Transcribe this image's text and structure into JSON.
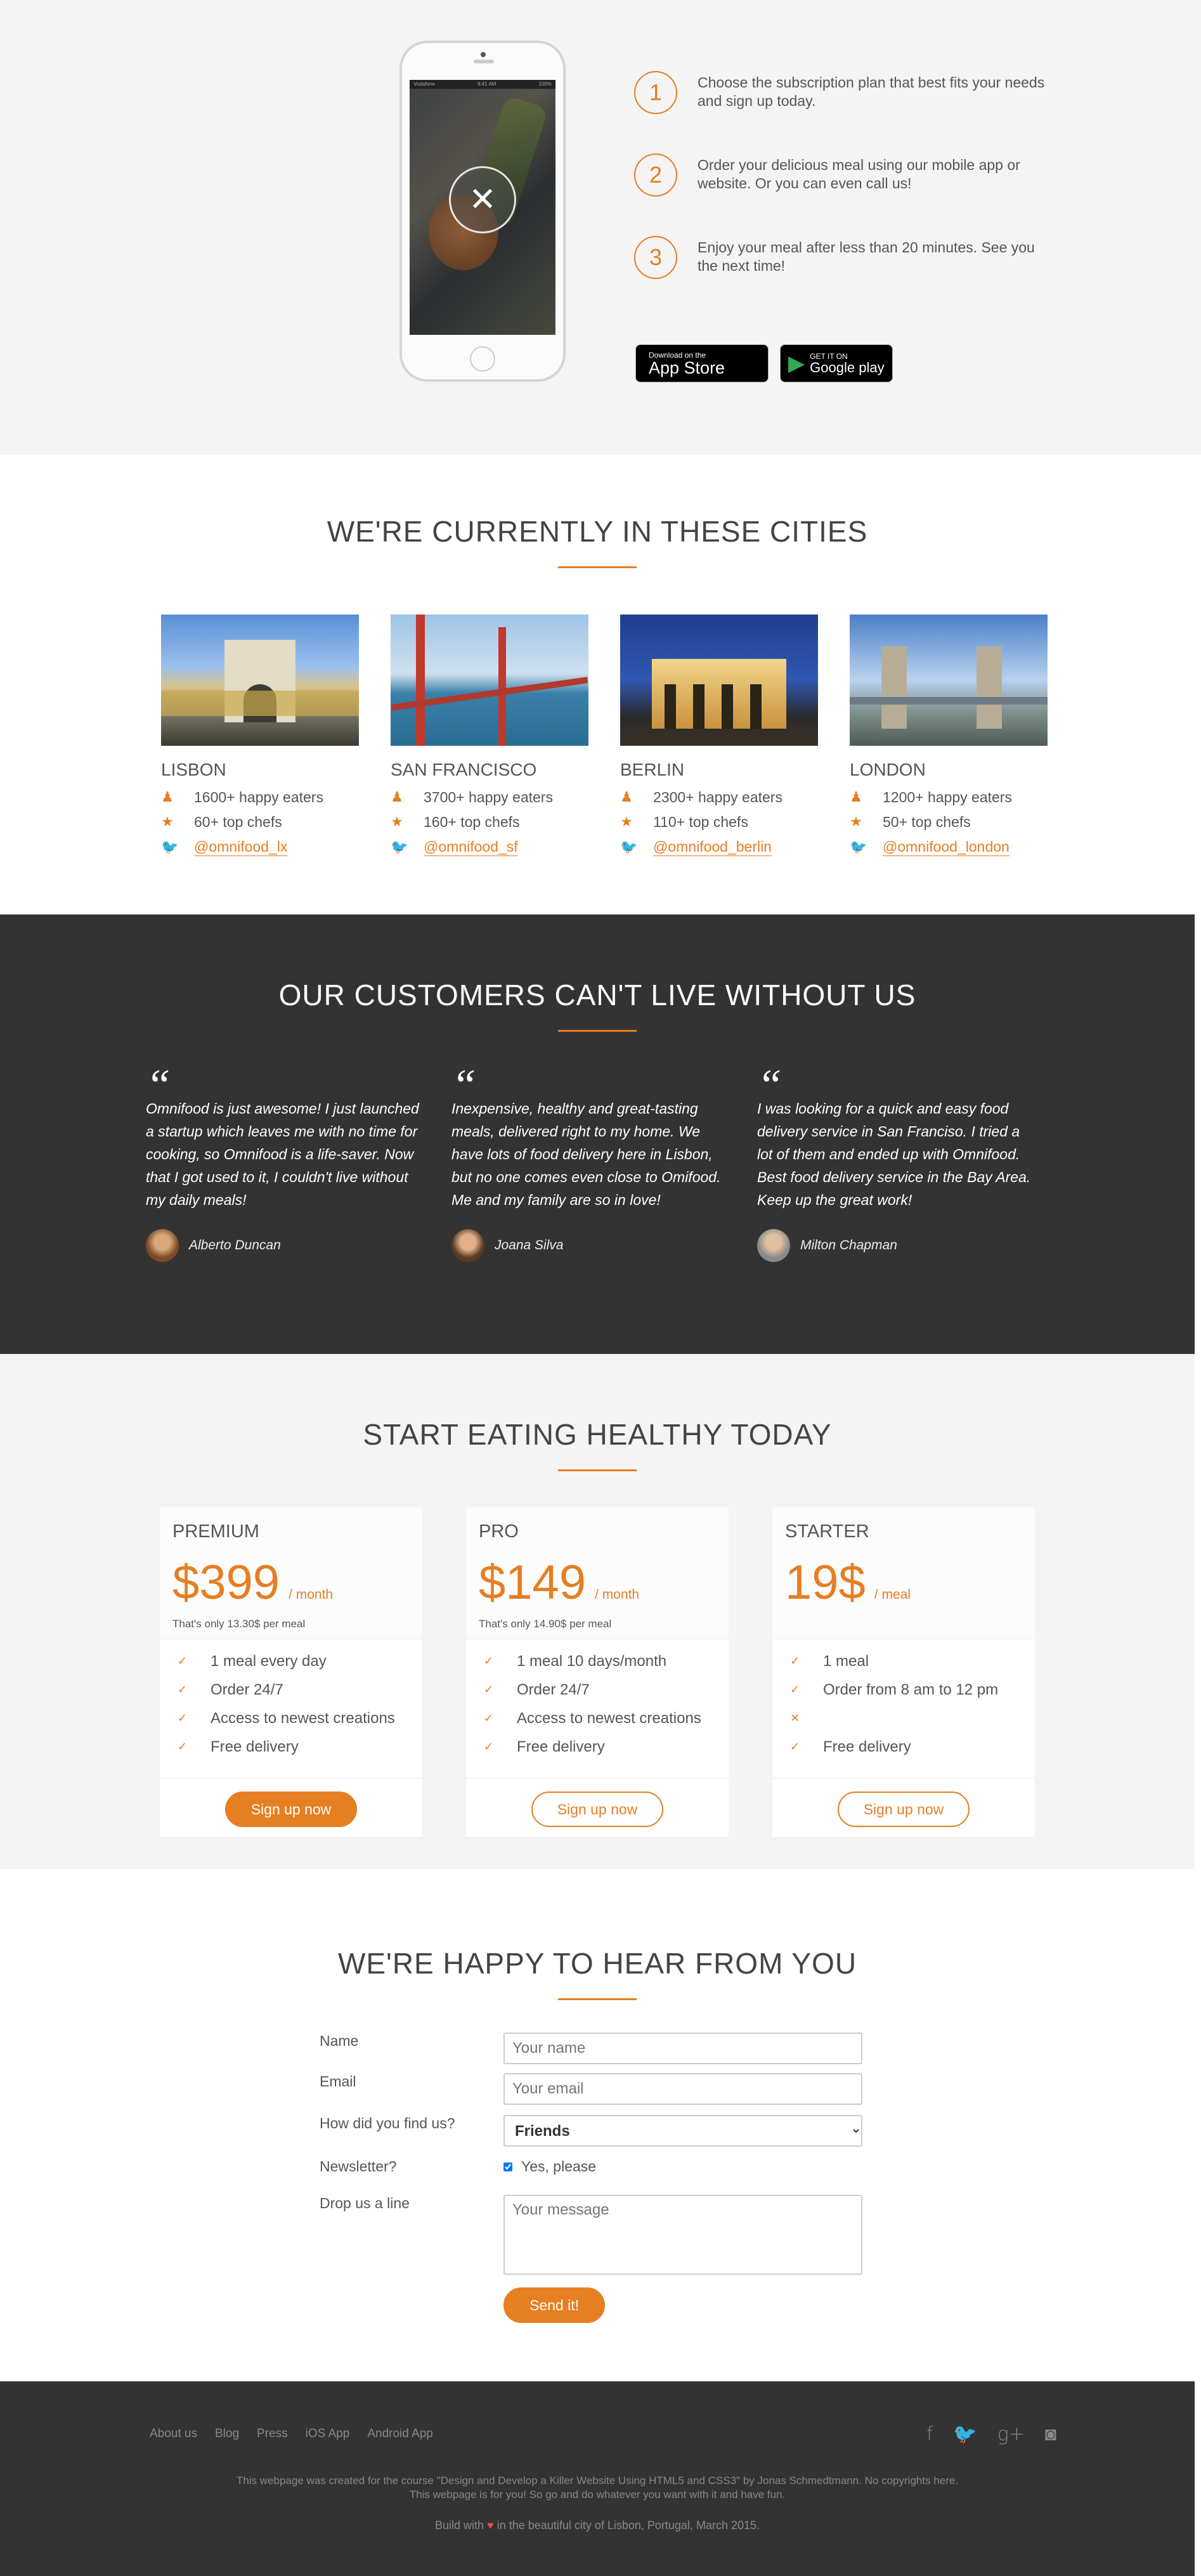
{
  "steps": {
    "items": [
      {
        "num": "1",
        "text": "Choose the subscription plan that best fits your needs and sign up today."
      },
      {
        "num": "2",
        "text": "Order your delicious meal using our mobile app or website. Or you can even call us!"
      },
      {
        "num": "3",
        "text": "Enjoy your meal after less than 20 minutes. See you the next time!"
      }
    ],
    "appstore": {
      "small": "Download on the",
      "big": "App Store",
      "icon": "apple-icon"
    },
    "googleplay": {
      "small": "GET IT ON",
      "big": "Google play",
      "icon": "play-icon"
    },
    "phone": {
      "carrier": "Vodafone",
      "time": "9:41 AM",
      "battery": "100%"
    }
  },
  "cities": {
    "title": "WE'RE CURRENTLY IN THESE CITIES",
    "items": [
      {
        "name": "LISBON",
        "eaters": "1600+ happy eaters",
        "chefs": "60+ top chefs",
        "twitter": "@omnifood_lx"
      },
      {
        "name": "SAN FRANCISCO",
        "eaters": "3700+ happy eaters",
        "chefs": "160+ top chefs",
        "twitter": "@omnifood_sf"
      },
      {
        "name": "BERLIN",
        "eaters": "2300+ happy eaters",
        "chefs": "110+ top chefs",
        "twitter": "@omnifood_berlin"
      },
      {
        "name": "LONDON",
        "eaters": "1200+ happy eaters",
        "chefs": "50+ top chefs",
        "twitter": "@omnifood_london"
      }
    ]
  },
  "testimonials": {
    "title": "OUR CUSTOMERS CAN'T LIVE WITHOUT US",
    "items": [
      {
        "text": "Omnifood is just awesome! I just launched a startup which leaves me with no time for cooking, so Omnifood is a life-saver. Now that I got used to it, I couldn't live without my daily meals!",
        "name": "Alberto Duncan"
      },
      {
        "text": "Inexpensive, healthy and great-tasting meals, delivered right to my home. We have lots of food delivery here in Lisbon, but no one comes even close to Omifood. Me and my family are so in love!",
        "name": "Joana Silva"
      },
      {
        "text": "I was looking for a quick and easy food delivery service in San Franciso. I tried a lot of them and ended up with Omnifood. Best food delivery service in the Bay Area. Keep up the great work!",
        "name": "Milton Chapman"
      }
    ]
  },
  "pricing": {
    "title": "START EATING HEALTHY TODAY",
    "plans": [
      {
        "name": "PREMIUM",
        "price": "$399",
        "per": "/ month",
        "note": "That's only 13.30$ per meal",
        "features": [
          "1 meal every day",
          "Order 24/7",
          "Access to newest creations",
          "Free delivery"
        ],
        "button": "Sign up now"
      },
      {
        "name": "PRO",
        "price": "$149",
        "per": "/ month",
        "note": "That's only 14.90$ per meal",
        "features": [
          "1 meal 10 days/month",
          "Order 24/7",
          "Access to newest creations",
          "Free delivery"
        ],
        "button": "Sign up now"
      },
      {
        "name": "STARTER",
        "price": "19$",
        "per": "/ meal",
        "note": "",
        "features": [
          "1 meal",
          "Order from 8 am to 12 pm",
          "",
          "Free delivery"
        ],
        "button": "Sign up now"
      }
    ]
  },
  "contact": {
    "title": "WE'RE HAPPY TO HEAR FROM YOU",
    "name_label": "Name",
    "name_placeholder": "Your name",
    "email_label": "Email",
    "email_placeholder": "Your email",
    "find_label": "How did you find us?",
    "find_value": "Friends",
    "newsletter_label": "Newsletter?",
    "newsletter_option": "Yes, please",
    "message_label": "Drop us a line",
    "message_placeholder": "Your message",
    "send": "Send it!"
  },
  "footer": {
    "nav": [
      "About us",
      "Blog",
      "Press",
      "iOS App",
      "Android App"
    ],
    "copy1": "This webpage was created for the course \"Design and Develop a Killer Website Using HTML5 and CSS3\" by Jonas Schmedtmann. No copyrights here.",
    "copy2": "This webpage is for you! So go and do whatever you want with it and have fun.",
    "build_before": "Build with",
    "build_after": "in the beautiful city of Lisbon, Portugal, March 2015."
  },
  "colors": {
    "accent": "#e67e22",
    "dark": "#333333",
    "light": "#f4f4f4"
  }
}
